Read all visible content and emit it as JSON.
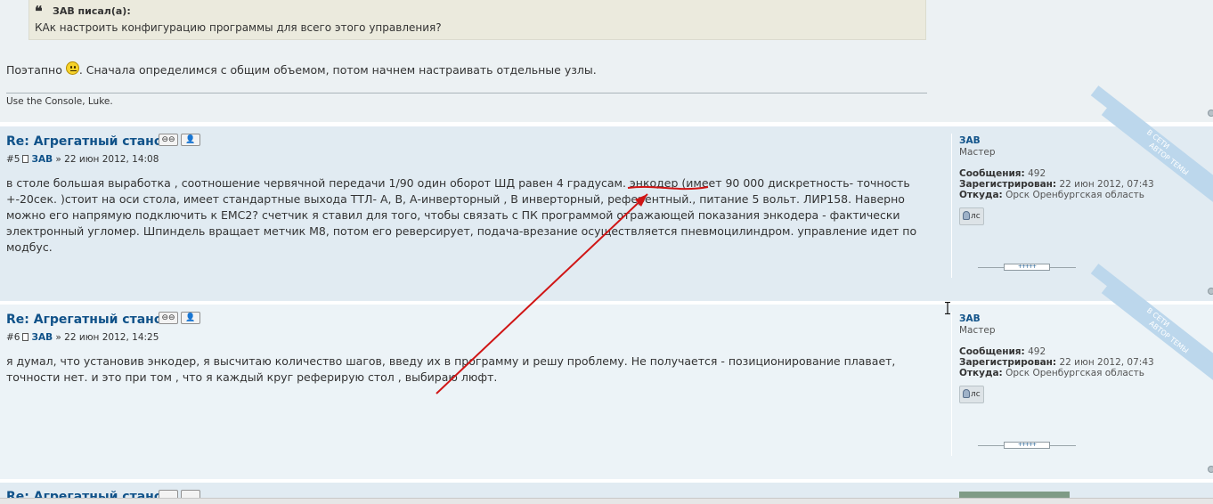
{
  "quote": {
    "author": "ЗАВ писал(а):",
    "text": "КАк настроить конфигурацию программы для всего этого управления?"
  },
  "top_post": {
    "text_before": "Поэтапно ",
    "text_after": ". Сначала определимся с общим объемом, потом начнем настраивать отдельные узлы.",
    "signature": "Use the Console, Luke."
  },
  "posts": [
    {
      "title": "Re: Агрегатный станок",
      "number": "#5",
      "author": "ЗАВ",
      "date": "» 22 июн 2012, 14:08",
      "body": "в столе большая выработка , соотношение червячной передачи 1/90 один оборот ШД равен 4 градусам. энкодер (имеет 90 000 дискретность- точность +-20сек. )стоит на оси стола, имеет стандартные выхода ТТЛ- А, В, А-инверторный , В инверторный, референтный., питание 5 вольт. ЛИР158. Наверно можно его напрямую подключить к ЕМС2? счетчик я ставил для того, чтобы связать с ПК программой отражающей показания энкодера - фактически электронный угломер. Шпиндель вращает метчик М8, потом его реверсирует, подача-врезание осуществляется пневмоцилиндром. управление идет по модбус.",
      "profile": {
        "username": "ЗАВ",
        "rank": "Мастер",
        "messages_label": "Сообщения:",
        "messages": "492",
        "registered_label": "Зарегистрирован:",
        "registered": "22 июн 2012, 07:43",
        "from_label": "Откуда:",
        "from": "Орск Оренбургская область",
        "pm": "лс"
      },
      "ribbon_1": "В СЕТИ",
      "ribbon_2": "АВТОР ТЕМЫ"
    },
    {
      "title": "Re: Агрегатный станок",
      "number": "#6",
      "author": "ЗАВ",
      "date": "» 22 июн 2012, 14:25",
      "body": "я думал, что установив энкодер, я высчитаю количество шагов, введу их в программу и решу проблему. Не получается - позиционирование плавает, точности нет. и это при том , что я каждый круг реферирую стол , выбираю люфт.",
      "profile": {
        "username": "ЗАВ",
        "rank": "Мастер",
        "messages_label": "Сообщения:",
        "messages": "492",
        "registered_label": "Зарегистрирован:",
        "registered": "22 июн 2012, 07:43",
        "from_label": "Откуда:",
        "from": "Орск Оренбургская область",
        "pm": "лс"
      },
      "ribbon_1": "В СЕТИ",
      "ribbon_2": "АВТОР ТЕМЫ"
    }
  ],
  "rating_label": "+++++",
  "bottom_post": {
    "title": "Re: Агрегатный станок"
  },
  "colors": {
    "link": "#105289",
    "post_bg_1": "#e1ebf2",
    "post_bg_2": "#ecf3f7",
    "annotation": "#d01515"
  },
  "icons": [
    "quote-icon",
    "smiley-icon",
    "link-icon",
    "profile-icon",
    "page-icon",
    "pm-icon",
    "back-to-top-icon",
    "text-cursor-icon"
  ]
}
